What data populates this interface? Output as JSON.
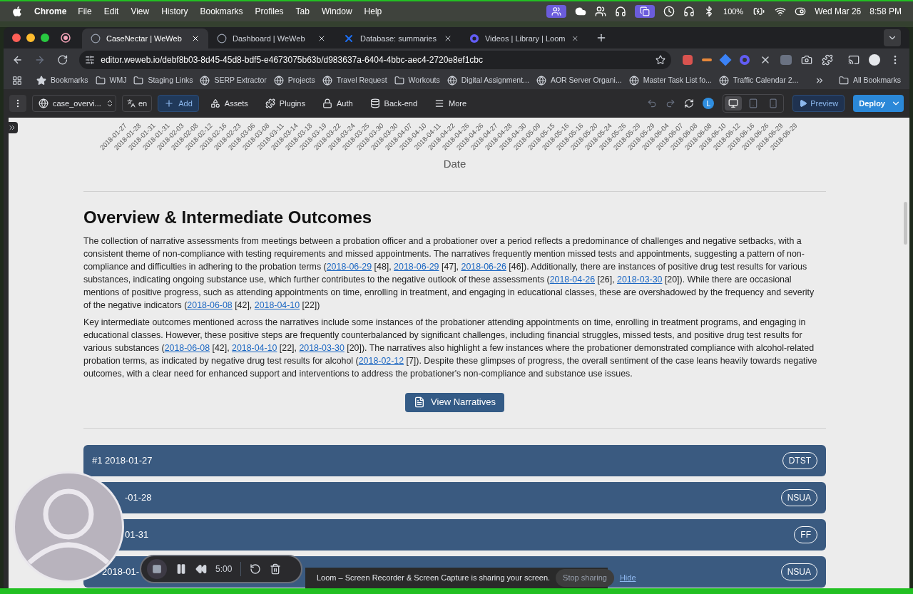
{
  "menubar": {
    "app": "Chrome",
    "menus": [
      "File",
      "Edit",
      "View",
      "History",
      "Bookmarks",
      "Profiles",
      "Tab",
      "Window",
      "Help"
    ],
    "battery": "100%",
    "date": "Wed Mar 26",
    "time": "8:58 PM"
  },
  "tabs": [
    {
      "title": "CaseNectar | WeWeb",
      "selected": true,
      "kind": "weweb"
    },
    {
      "title": "Dashboard | WeWeb",
      "selected": false,
      "kind": "weweb"
    },
    {
      "title": "Database: summaries",
      "selected": false,
      "kind": "x"
    },
    {
      "title": "Videos | Library | Loom",
      "selected": false,
      "kind": "loom"
    }
  ],
  "address": {
    "url": "editor.weweb.io/debf8b03-8d45-45d8-bdf5-e4673075b63b/d983637a-6404-4bbc-aec4-2720e8ef1cbc"
  },
  "bookmarks": [
    {
      "label": "Bookmarks",
      "kind": "star"
    },
    {
      "label": "WMJ",
      "kind": "folder"
    },
    {
      "label": "Staging Links",
      "kind": "folder"
    },
    {
      "label": "SERP Extractor",
      "kind": "site"
    },
    {
      "label": "Projects",
      "kind": "site"
    },
    {
      "label": "Travel Request",
      "kind": "site"
    },
    {
      "label": "Workouts",
      "kind": "folder"
    },
    {
      "label": "Digital Assignment...",
      "kind": "site"
    },
    {
      "label": "AOR Server Organi...",
      "kind": "site"
    },
    {
      "label": "Master Task List fo...",
      "kind": "site"
    },
    {
      "label": "Traffic Calendar 2...",
      "kind": "site"
    }
  ],
  "all_bookmarks": "All Bookmarks",
  "editor_toolbar": {
    "page": "case_overvi...",
    "language": "en",
    "items": [
      {
        "label": "Add",
        "kind": "add"
      },
      {
        "label": "Assets",
        "kind": "assets"
      },
      {
        "label": "Plugins",
        "kind": "plugins"
      },
      {
        "label": "Auth",
        "kind": "auth"
      },
      {
        "label": "Back-end",
        "kind": "backend"
      },
      {
        "label": "More",
        "kind": "more"
      }
    ],
    "user_initial": "L",
    "devices": [
      {
        "kind": "desktop",
        "selected": true
      },
      {
        "kind": "tablet",
        "selected": false
      },
      {
        "kind": "mobile",
        "selected": false
      }
    ],
    "preview": "Preview",
    "deploy": "Deploy"
  },
  "page": {
    "x_axis": {
      "title": "Date",
      "labels": [
        "2018-01-27",
        "2018-01-28",
        "2018-01-31",
        "2018-01-31",
        "2018-02-03",
        "2018-02-08",
        "2018-02-12",
        "2018-02-16",
        "2018-02-23",
        "2018-03-06",
        "2018-03-08",
        "2018-03-11",
        "2018-03-14",
        "2018-03-18",
        "2018-03-19",
        "2018-03-22",
        "2018-03-24",
        "2018-03-25",
        "2018-03-30",
        "2018-03-30",
        "2018-04-07",
        "2018-04-10",
        "2018-04-11",
        "2018-04-22",
        "2018-04-26",
        "2018-04-26",
        "2018-04-27",
        "2018-04-28",
        "2018-04-30",
        "2018-05-09",
        "2018-05-15",
        "2018-05-16",
        "2018-05-16",
        "2018-05-20",
        "2018-05-24",
        "2018-05-26",
        "2018-05-29",
        "2018-05-29",
        "2018-06-04",
        "2018-06-07",
        "2018-06-08",
        "2018-06-08",
        "2018-06-10",
        "2018-06-12",
        "2018-06-16",
        "2018-06-26",
        "2018-06-29",
        "2018-06-29"
      ]
    },
    "heading": "Overview & Intermediate Outcomes",
    "paragraphs": [
      [
        {
          "text": "The collection of narrative assessments from meetings between a probation officer and a probationer over a period reflects a predominance of challenges and negative setbacks, with a consistent theme of non-compliance with testing requirements and missed appointments. The narratives frequently mention missed tests and appointments, suggesting a pattern of non-compliance and difficulties in adhering to the probation terms ("
        },
        {
          "link": "2018-06-29"
        },
        {
          "text": " [48], "
        },
        {
          "link": "2018-06-29"
        },
        {
          "text": " [47], "
        },
        {
          "link": "2018-06-26"
        },
        {
          "text": " [46]). Additionally, there are instances of positive drug test results for various substances, indicating ongoing substance use, which further contributes to the negative outlook of these assessments ("
        },
        {
          "link": "2018-04-26"
        },
        {
          "text": " [26], "
        },
        {
          "link": "2018-03-30"
        },
        {
          "text": " [20]). While there are occasional mentions of positive progress, such as attending appointments on time, enrolling in treatment, and engaging in educational classes, these are overshadowed by the frequency and severity of the negative indicators ("
        },
        {
          "link": "2018-06-08"
        },
        {
          "text": " [42], "
        },
        {
          "link": "2018-04-10"
        },
        {
          "text": " [22])"
        }
      ],
      [
        {
          "text": "Key intermediate outcomes mentioned across the narratives include some instances of the probationer attending appointments on time, enrolling in treatment programs, and engaging in educational classes. However, these positive steps are frequently counterbalanced by significant challenges, including financial struggles, missed tests, and positive drug test results for various substances ("
        },
        {
          "link": "2018-06-08"
        },
        {
          "text": " [42], "
        },
        {
          "link": "2018-04-10"
        },
        {
          "text": " [22], "
        },
        {
          "link": "2018-03-30"
        },
        {
          "text": " [20]). The narratives also highlight a few instances where the probationer demonstrated compliance with alcohol-related probation terms, as indicated by negative drug test results for alcohol ("
        },
        {
          "link": "2018-02-12"
        },
        {
          "text": " [7]). Despite these glimpses of progress, the overall sentiment of the case leans heavily towards negative outcomes, with a clear need for enhanced support and interventions to address the probationer's non-compliance and substance use issues."
        }
      ]
    ],
    "button": "View Narratives",
    "narratives": [
      {
        "label": "#1 2018-01-27",
        "tag": "DTST"
      },
      {
        "label": "-01-28",
        "tag": "NSUA"
      },
      {
        "label": "01-31",
        "tag": "FF"
      },
      {
        "label": "2018-01-",
        "tag": "NSUA"
      }
    ]
  },
  "loom": {
    "timer": "5:00",
    "message": "Loom – Screen Recorder & Screen Capture is sharing your screen.",
    "stop": "Stop sharing",
    "hide": "Hide"
  }
}
